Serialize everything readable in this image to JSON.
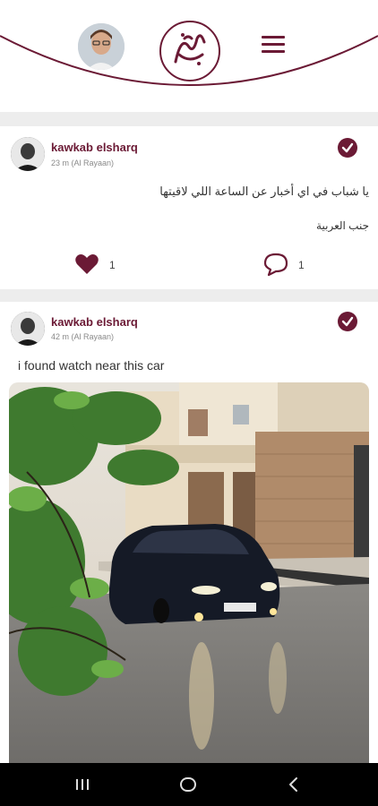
{
  "header": {
    "avatar": "user-avatar",
    "logo": "calligraphy-logo",
    "menu": "hamburger-menu-icon"
  },
  "posts": [
    {
      "author": "kawkab elsharq",
      "meta": "23 m (Al Rayaan)",
      "lines": [
        "يا شباب في اي أخبار عن الساعة اللي لاقيتها",
        "جنب العربية"
      ],
      "likes": "1",
      "comments": "1"
    },
    {
      "author": "kawkab elsharq",
      "meta": "42 m (Al Rayaan)",
      "text": "i found watch near this car",
      "image": "photo of dark sedan car on street next to buildings"
    }
  ],
  "colors": {
    "accent": "#6b1a35",
    "background": "#ededed",
    "navbar": "#000000"
  },
  "navbar": {
    "icons": [
      "recent-apps-icon",
      "home-icon",
      "back-icon"
    ]
  }
}
